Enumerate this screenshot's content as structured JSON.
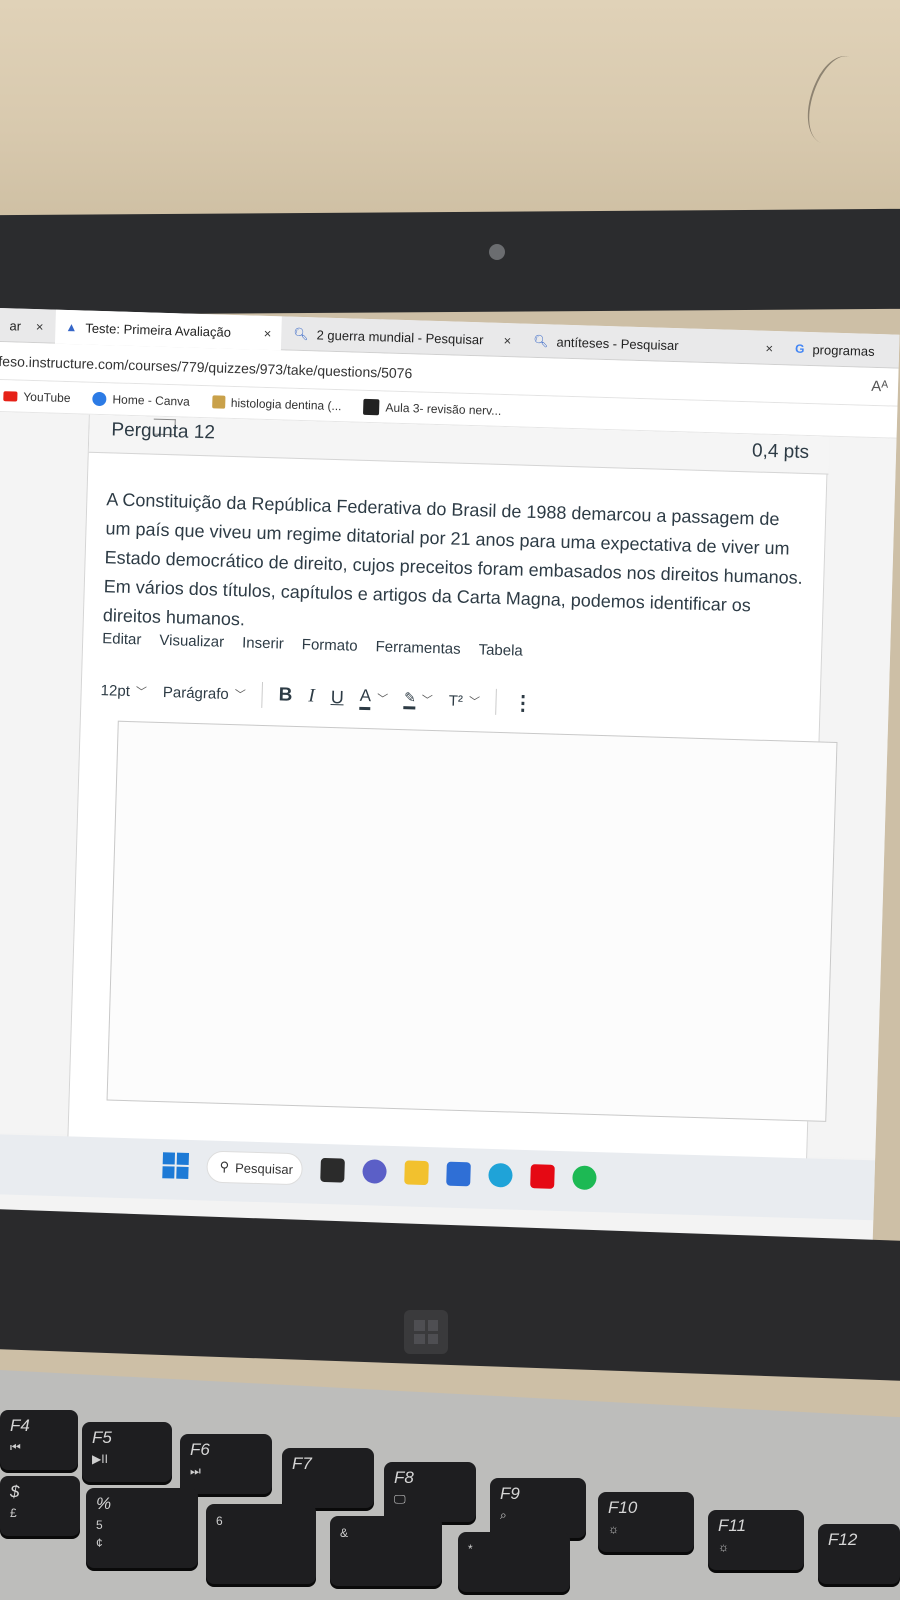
{
  "browser": {
    "tabs": [
      {
        "label": "ar",
        "close": "×"
      },
      {
        "label": "Teste: Primeira Avaliação",
        "close": "×"
      },
      {
        "label": "2 guerra mundial - Pesquisar",
        "close": "×"
      },
      {
        "label": "antíteses - Pesquisar",
        "close": "×"
      },
      {
        "label": "programas",
        "close": ""
      }
    ],
    "url": "feso.instructure.com/courses/779/quizzes/973/take/questions/5076",
    "reader_label": "Aᴬ",
    "bookmarks": [
      "YouTube",
      "Home - Canva",
      "histologia dentina (...",
      "Aula 3- revisão nerv..."
    ]
  },
  "question": {
    "title": "Pergunta 12",
    "points": "0,4 pts",
    "text": "A Constituição da República Federativa do Brasil de 1988 demarcou a passagem de um país que viveu um regime ditatorial por 21 anos para uma expectativa de viver um Estado democrático de direito, cujos preceitos foram embasados nos direitos humanos. Em vários dos títulos, capítulos e artigos da Carta Magna, podemos identificar os direitos humanos."
  },
  "editor": {
    "menu": [
      "Editar",
      "Visualizar",
      "Inserir",
      "Formato",
      "Ferramentas",
      "Tabela"
    ],
    "font_size": "12pt",
    "block_format": "Parágrafo",
    "bold": "B",
    "italic": "I",
    "underline": "U",
    "text_color": "A",
    "superscript": "T²",
    "more": "⋮",
    "content": ""
  },
  "taskbar": {
    "search_label": "Pesquisar"
  },
  "keyboard": {
    "fkeys": [
      "F4",
      "F5",
      "F6",
      "F7",
      "F8",
      "F9",
      "F10",
      "F11",
      "F12"
    ],
    "fkey_icons": [
      "⏮",
      "▶II",
      "⏭",
      "",
      "🖵",
      "⌕",
      "☼",
      "☼",
      ""
    ],
    "number_keys": [
      "$",
      "£",
      "%",
      "5",
      "¢",
      "6",
      "&",
      "*"
    ]
  },
  "colors": {
    "accent": "#1d7ad6",
    "text": "#2d3b45",
    "youtube": "#e62117",
    "netflix": "#e50914",
    "spotify": "#1db954"
  }
}
